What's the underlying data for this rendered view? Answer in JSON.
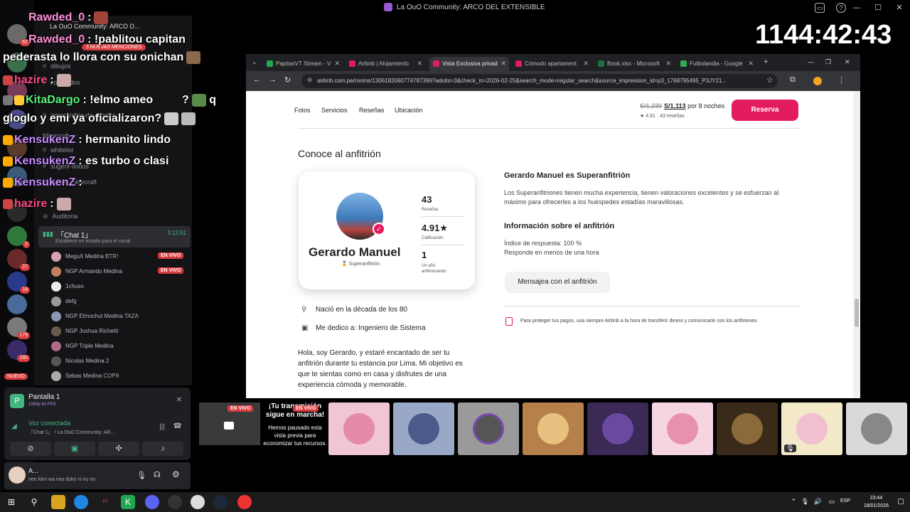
{
  "window": {
    "title": "La OuO Community: ARCO DEL EXTENSIBLE"
  },
  "stream_timer": "1144:42:43",
  "discord": {
    "guild_name": "La OuO Community: ARCO D...",
    "mentions_pill": "3 NUEVAS MENCIONES",
    "nuevo_badge": "NUEVO",
    "server_badges": [
      "62",
      "2",
      "27",
      "18",
      "179",
      "180"
    ],
    "channels": [
      {
        "label": "dibujos"
      },
      {
        "label": "comandos"
      },
      {
        "label": "intercambio-de-regalos"
      },
      {
        "label": "Minecraft"
      },
      {
        "label": "whitelist"
      },
      {
        "label": "sugerir-lindos"
      },
      {
        "label": "server-minecraft"
      },
      {
        "label": "Auditoria"
      }
    ],
    "chat_overlay": [
      {
        "user": "Rawded_0",
        "text": ":",
        "color": "#ff8fd6"
      },
      {
        "user": "Rawded_0",
        "text": ": !pablitou capitan",
        "color": "#ff8fd6"
      },
      {
        "user": "",
        "text": "pederasta lo llora con su onichan",
        "color": "#ffffff"
      },
      {
        "user": "hazire",
        "text": ":",
        "color": "#ff4d8d"
      },
      {
        "user": "KitaDargo",
        "text": ": !elmo ameo",
        "color": "#5af27a"
      },
      {
        "user": "",
        "text": "q",
        "color": "#ffffff"
      },
      {
        "user": "",
        "text": "gloglo y emi ya oficializaron?",
        "color": "#ffffff"
      },
      {
        "user": "KensukenZ",
        "text": ": hermanito lindo",
        "color": "#c98cff"
      },
      {
        "user": "KensukenZ",
        "text": ": es turbo o clasi",
        "color": "#c98cff"
      },
      {
        "user": "KensukenZ",
        "text": ":",
        "color": "#c98cff"
      },
      {
        "user": "hazire",
        "text": ":",
        "color": "#ff4d8d"
      },
      {
        "user": "",
        "text": "?",
        "color": "#ffffff"
      }
    ],
    "voice_channel": {
      "name": "「Chat 1」",
      "status": "Establece un estado para el canal",
      "time": "3:12:51"
    },
    "voice_users": [
      {
        "name": "MeguX Medina",
        "tag": "BTR!",
        "live": "EN VIVO"
      },
      {
        "name": "NGP Armando Medina",
        "tag": "",
        "live": "EN VIVO"
      },
      {
        "name": "1chuso",
        "tag": "",
        "live": ""
      },
      {
        "name": "defg",
        "tag": "",
        "live": ""
      },
      {
        "name": "NGP Elmochul Medina",
        "tag": "TAZA",
        "live": ""
      },
      {
        "name": "NGP Joshua Richetti",
        "tag": "",
        "live": ""
      },
      {
        "name": "NGP Triple Medina",
        "tag": "",
        "live": ""
      },
      {
        "name": "Nicolas Medina 2",
        "tag": "",
        "live": ""
      },
      {
        "name": "Sebas Medina",
        "tag": "COP9",
        "live": ""
      }
    ],
    "stream_panel": {
      "screen_name": "Pantalla 1",
      "quality": "1080p 60 FPS",
      "voice_connected": "Voz conectada",
      "voice_sub": "「Chat 1」 / La OuO Community: AR..."
    },
    "user": {
      "name": "A...",
      "status": "nee kimi wa ima doko ni iru no"
    }
  },
  "browser": {
    "tabs": [
      {
        "label": "PapitasVT Stream - V",
        "color": "#1fa84f"
      },
      {
        "label": "Airbnb | Alojamiento",
        "color": "#e31c5f"
      },
      {
        "label": "Vista Exclusiva privad",
        "color": "#e31c5f"
      },
      {
        "label": "Cómodo apartament",
        "color": "#e31c5f"
      },
      {
        "label": "Book.xlsx - Microsoft",
        "color": "#1d6f42"
      },
      {
        "label": "Futbolandia - Google",
        "color": "#34a853"
      }
    ],
    "url": "airbnb.com.pe/rooms/1306182060774787396?adults=3&check_in=2026-02-25&search_mode=regular_search&source_impression_id=p3_1768795495_P3JY21...",
    "page": {
      "subnav": [
        "Fotos",
        "Servicios",
        "Reseñas",
        "Ubicación"
      ],
      "old_price": "S/1,239",
      "new_price": "S/1,113",
      "price_suffix": "por 8 noches",
      "rating_line": "★ 4.91 · 43 reseñas",
      "reserve": "Reserva",
      "section_title": "Conoce al anfitrión",
      "host_name": "Gerardo Manuel",
      "superhost_label": "Superanfitrión",
      "stats": [
        {
          "num": "43",
          "label": "Reseñas"
        },
        {
          "num": "4.91★",
          "label": "Calificación"
        },
        {
          "num": "1",
          "label": "Un año anfitrionando"
        }
      ],
      "superhost_title": "Gerardo Manuel es Superanfitrión",
      "superhost_text": "Los Superanfitriones tienen mucha experiencia, tienen valoraciones excelentes y se esfuerzan al máximo para ofrecerles a los huéspedes estadías maravillosas.",
      "info_title": "Información sobre el anfitrión",
      "response_rate": "Índice de respuesta: 100 %",
      "response_time": "Responde en menos de una hora",
      "message_button": "Mensajea con el anfitrión",
      "fact_born": "Nació en la década de los 80",
      "fact_work": "Me dedico a: Ingeniero de Sistema",
      "bio": "Hola, soy Gerardo, y estaré encantado de ser tu anfitrión durante tu estancia por Lima. Mi objetivo es que te sientas como en casa y disfrutes de una experiencia cómoda y memorable.",
      "protect_text": "Para proteger tus pagos, usa siempre Airbnb a la hora de transferir dinero y comunicarte con los anfitriones."
    }
  },
  "stream_area": {
    "live_label": "EN VIVO",
    "paused_title": "¡Tu transmisión sigue en marcha!",
    "paused_text": "Hemos pausado esta vista previa para economizar tus recursos.",
    "tile_colors": [
      "#f0c6d2",
      "#9aa8c8",
      "#9a9a9a",
      "#b5804a",
      "#3a2a55",
      "#f5d5e2",
      "#3a2a1a",
      "#f3e8c8",
      "#d9d9d9"
    ]
  },
  "taskbar": {
    "lang": "ESP",
    "time": "23:44",
    "date": "18/01/2026"
  }
}
